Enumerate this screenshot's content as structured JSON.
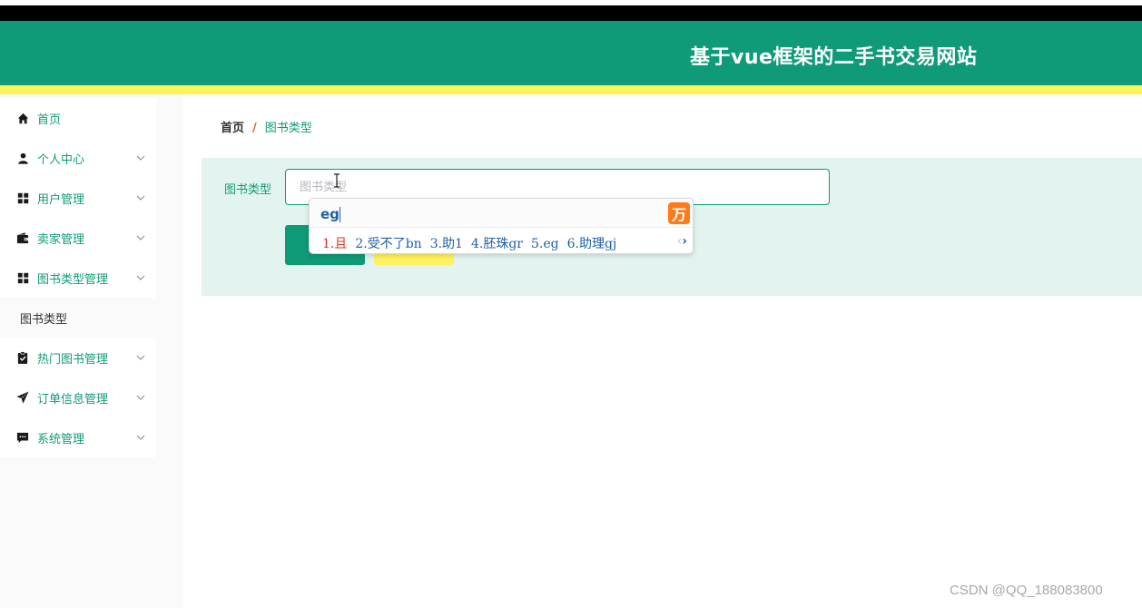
{
  "header": {
    "title": "基于vue框架的二手书交易网站"
  },
  "sidebar": {
    "items": [
      {
        "label": "首页",
        "icon": "home-icon",
        "expandable": false
      },
      {
        "label": "个人中心",
        "icon": "user-icon",
        "expandable": true
      },
      {
        "label": "用户管理",
        "icon": "grid-icon",
        "expandable": true
      },
      {
        "label": "卖家管理",
        "icon": "wallet-icon",
        "expandable": true
      },
      {
        "label": "图书类型管理",
        "icon": "grid-icon",
        "expandable": true
      },
      {
        "label": "热门图书管理",
        "icon": "clipboard-check-icon",
        "expandable": true
      },
      {
        "label": "订单信息管理",
        "icon": "paper-plane-icon",
        "expandable": true
      },
      {
        "label": "系统管理",
        "icon": "chat-icon",
        "expandable": true
      }
    ],
    "submenu": {
      "label": "图书类型"
    }
  },
  "breadcrumb": {
    "home": "首页",
    "separator": "/",
    "current": "图书类型"
  },
  "search": {
    "label": "图书类型",
    "placeholder": "图书类型",
    "value": ""
  },
  "ime": {
    "composition": "eg",
    "candidates": [
      "1.且",
      "2.受不了bn",
      "3.助1",
      "4.胚珠gr",
      "5.eg",
      "6.助理gj"
    ],
    "logo": "万"
  },
  "colors": {
    "primary": "#0f9b78",
    "accent": "#fff35c",
    "panel": "#e3f3ef"
  },
  "watermark": "CSDN @QQ_188083800"
}
